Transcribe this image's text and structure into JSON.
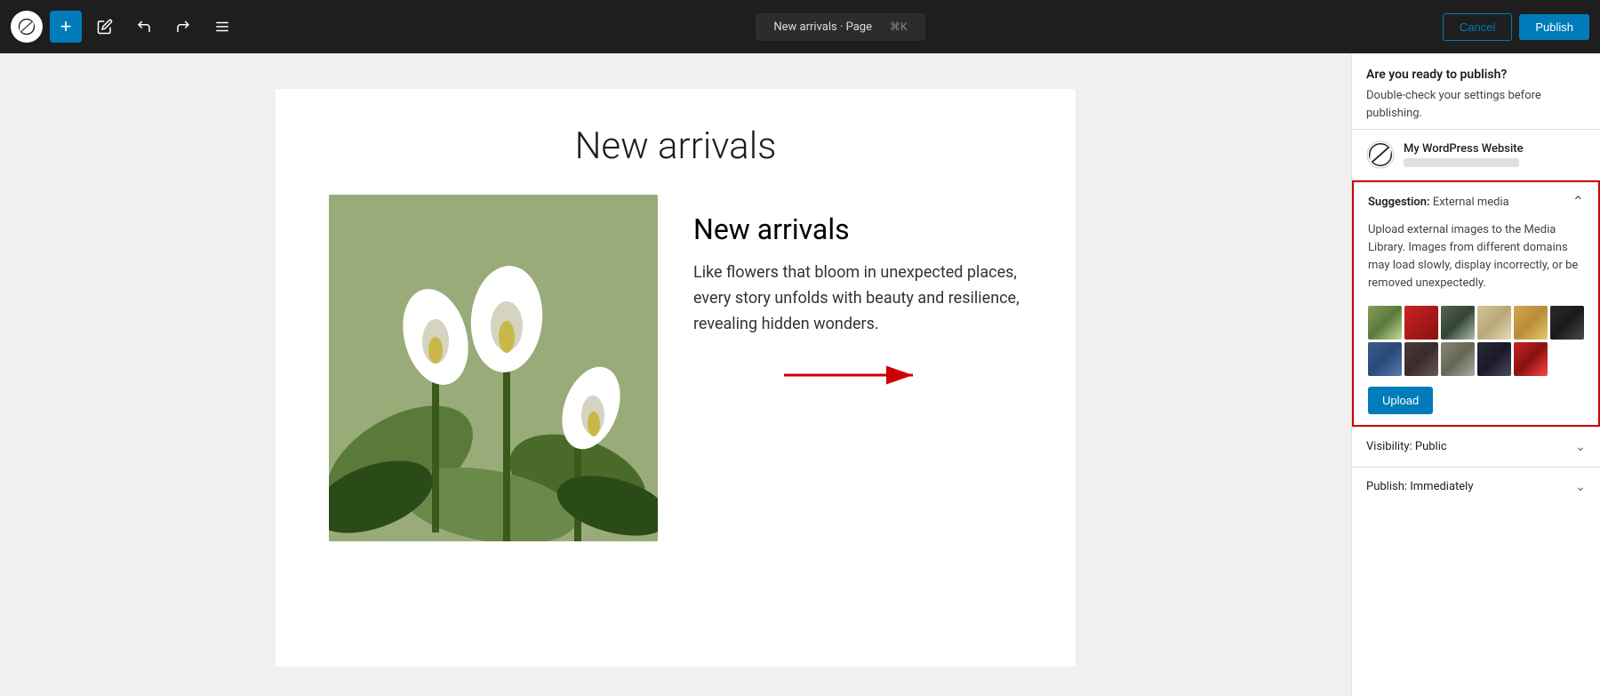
{
  "toolbar": {
    "add_label": "+",
    "page_title": "New arrivals · Page",
    "shortcut": "⌘K",
    "cancel_label": "Cancel",
    "publish_label": "Publish"
  },
  "editor": {
    "title": "New arrivals",
    "subtitle": "New arrivals",
    "body_text": "Like flowers that bloom in unexpected places, every story unfolds with beauty and resilience, revealing hidden wonders."
  },
  "sidebar": {
    "question": "Are you ready to publish?",
    "description": "Double-check your settings before publishing.",
    "site_name": "My WordPress Website",
    "suggestion_label": "Suggestion:",
    "suggestion_type": "External media",
    "suggestion_text": "Upload external images to the Media Library. Images from different domains may load slowly, display incorrectly, or be removed unexpectedly.",
    "upload_label": "Upload",
    "visibility_label": "Visibility: Public",
    "publish_time_label": "Publish: Immediately"
  }
}
